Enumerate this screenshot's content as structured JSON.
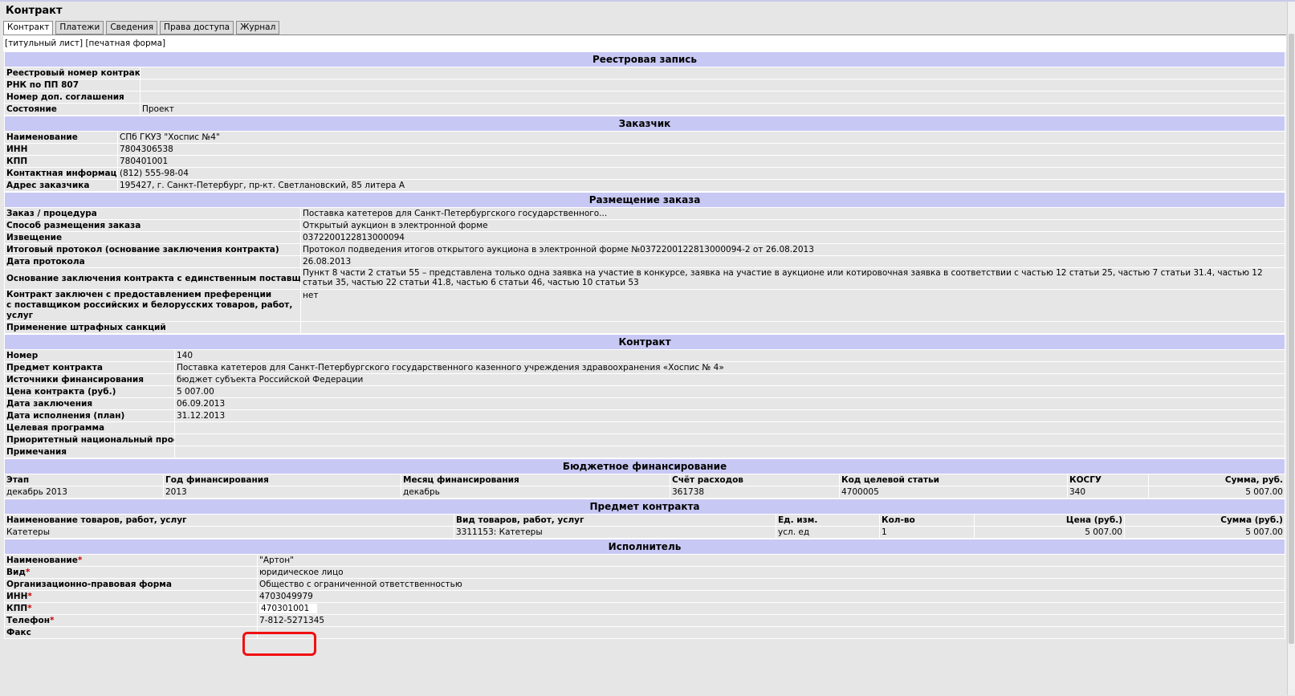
{
  "title": "Контракт",
  "tabs": [
    "Контракт",
    "Платежи",
    "Сведения",
    "Права доступа",
    "Журнал"
  ],
  "links": [
    "[титульный лист]",
    "[печатная форма]"
  ],
  "registry": {
    "header": "Реестровая запись",
    "rows": [
      {
        "label": "Реестровый номер контракта",
        "value": ""
      },
      {
        "label": "РНК по ПП 807",
        "value": ""
      },
      {
        "label": "Номер доп. соглашения",
        "value": ""
      },
      {
        "label": "Состояние",
        "value": "Проект"
      }
    ]
  },
  "customer": {
    "header": "Заказчик",
    "rows": [
      {
        "label": "Наименование",
        "value": "СПб ГКУЗ \"Хоспис №4\""
      },
      {
        "label": "ИНН",
        "value": "7804306538"
      },
      {
        "label": "КПП",
        "value": "780401001"
      },
      {
        "label": "Контактная информация",
        "value": "(812) 555-98-04"
      },
      {
        "label": "Адрес заказчика",
        "value": "195427, г. Санкт-Петербург, пр-кт. Светлановский, 85 литера А"
      }
    ]
  },
  "placement": {
    "header": "Размещение заказа",
    "rows": [
      {
        "label": "Заказ / процедура",
        "value": "Поставка катетеров для Санкт-Петербургского государственного..."
      },
      {
        "label": "Способ размещения заказа",
        "value": "Открытый аукцион в электронной форме"
      },
      {
        "label": "Извещение",
        "value": "0372200122813000094"
      },
      {
        "label": "Итоговый протокол (основание заключения контракта)",
        "value": "Протокол подведения итогов открытого аукциона в электронной форме №0372200122813000094-2 от 26.08.2013"
      },
      {
        "label": "Дата протокола",
        "value": "26.08.2013"
      },
      {
        "label": "Основание заключения контракта с единственным поставщиком",
        "value": "Пункт 8 части 2 статьи 55 – представлена только одна заявка на участие в конкурсе, заявка на участие в аукционе или котировочная заявка в соответствии с частью 12 статьи 25, частью 7 статьи 31.4, частью 12 статьи 35, частью 22 статьи 41.8, частью 6 статьи 46, частью 10 статьи 53"
      },
      {
        "label": "Контракт заключен с предоставлением преференции с поставщиком российских и белорусских товаров, работ, услуг",
        "label_line1": "Контракт заключен с предоставлением преференции",
        "label_line2": "с поставщиком российских и белорусских товаров, работ, услуг",
        "value": "нет"
      },
      {
        "label": "Применение штрафных санкций",
        "value": ""
      }
    ]
  },
  "contract": {
    "header": "Контракт",
    "rows": [
      {
        "label": "Номер",
        "value": "140"
      },
      {
        "label": "Предмет контракта",
        "value": "Поставка катетеров для Санкт-Петербургского государственного казенного учреждения здравоохранения «Хоспис № 4»"
      },
      {
        "label": "Источники финансирования",
        "value": "бюджет субъекта Российской Федерации"
      },
      {
        "label": "Цена контракта (руб.)",
        "value": "5 007.00"
      },
      {
        "label": "Дата заключения",
        "value": "06.09.2013"
      },
      {
        "label": "Дата исполнения (план)",
        "value": "31.12.2013"
      },
      {
        "label": "Целевая программа",
        "value": ""
      },
      {
        "label": "Приоритетный национальный проект",
        "value": ""
      },
      {
        "label": "Примечания",
        "value": ""
      }
    ]
  },
  "budget": {
    "header": "Бюджетное финансирование",
    "columns": [
      "Этап",
      "Год финансирования",
      "Месяц финансирования",
      "Счёт расходов",
      "Код целевой статьи",
      "КОСГУ",
      "Сумма, руб."
    ],
    "rows": [
      [
        "декабрь 2013",
        "2013",
        "декабрь",
        "361738",
        "4700005",
        "340",
        "5 007.00"
      ]
    ]
  },
  "subject": {
    "header": "Предмет контракта",
    "columns": [
      "Наименование товаров, работ, услуг",
      "Вид товаров, работ, услуг",
      "Ед. изм.",
      "Кол-во",
      "Цена (руб.)",
      "Сумма (руб.)"
    ],
    "rows": [
      [
        "Катетеры",
        "3311153: Катетеры",
        "усл. ед",
        "1",
        "5 007.00",
        "5 007.00"
      ]
    ]
  },
  "executor": {
    "header": "Исполнитель",
    "rows": [
      {
        "label": "Наименование",
        "value": "\"Артон\"",
        "required": "*"
      },
      {
        "label": "Вид",
        "value": "юридическое лицо",
        "required": "*"
      },
      {
        "label": "Организационно-правовая форма",
        "value": "Общество с ограниченной ответственностью",
        "required": ""
      },
      {
        "label": "ИНН",
        "value": "4703049979",
        "required": "*"
      },
      {
        "label": "КПП",
        "value": "470301001",
        "required": "*"
      },
      {
        "label": "Телефон",
        "value": "7-812-5271345",
        "required": "*"
      },
      {
        "label": "Факс",
        "value": "",
        "required": ""
      }
    ]
  },
  "colors": {
    "section_header": "#c8c8f5",
    "highlight": "#f01010",
    "required": "#cc0000"
  }
}
